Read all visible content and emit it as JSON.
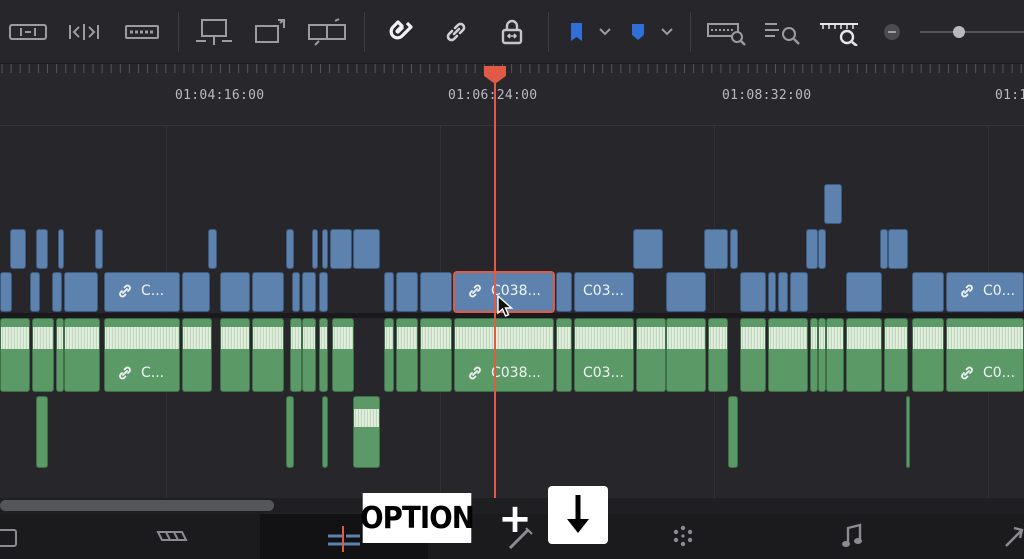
{
  "ruler": {
    "timecodes": [
      "01:04:16:00",
      "01:06:24:00",
      "01:08:32:00",
      "01:1"
    ]
  },
  "clips": {
    "video_label_c": "C...",
    "video_label_selected": "C038...",
    "video_label_c03": "C03...",
    "video_label_c0": "C0...",
    "audio_label_c": "C...",
    "audio_label_selected": "C038...",
    "audio_label_c03": "C03...",
    "audio_label_c0": "C0..."
  },
  "overlay": {
    "key1": "OPTION",
    "plus": "+"
  },
  "colors": {
    "video_clip": "#5d82ad",
    "audio_clip": "#5b9a66",
    "playhead": "#e05a45",
    "flag_blue": "#2f6fd6"
  },
  "icons": {
    "toolbar": [
      "trim-edit-icon",
      "dynamic-trim-icon",
      "blade-icon",
      "insert-clip-icon",
      "overwrite-clip-icon",
      "replace-clip-icon",
      "snapping-magnet-icon",
      "linked-selection-icon",
      "position-lock-icon",
      "flag-icon",
      "marker-icon",
      "zoom-full-icon",
      "zoom-detail-icon",
      "zoom-custom-icon",
      "zoom-out-icon"
    ],
    "pages": [
      "media-page-icon",
      "cut-page-icon",
      "edit-page-icon",
      "fusion-page-icon",
      "color-page-icon",
      "fairlight-page-icon",
      "deliver-page-icon"
    ]
  },
  "zoom": {
    "level_fraction": 0.35
  }
}
